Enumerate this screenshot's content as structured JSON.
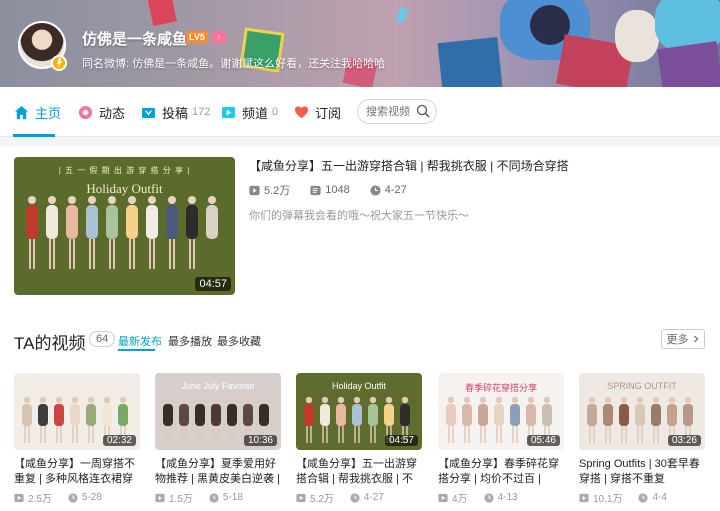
{
  "profile": {
    "name": "仿佛是一条咸鱼",
    "level": "LV5",
    "gender_badge": "♀",
    "sign": "同名微博: 仿佛是一条咸鱼。谢谢赋这么好看，还关注我哈哈哈"
  },
  "nav": {
    "items": [
      {
        "label": "主页",
        "icon": "home-icon",
        "active": true
      },
      {
        "label": "动态",
        "icon": "activity-icon"
      },
      {
        "label": "投稿",
        "icon": "upload-icon",
        "count": "172"
      },
      {
        "label": "频道",
        "icon": "channel-icon",
        "count": "0"
      },
      {
        "label": "订阅",
        "icon": "heart-icon"
      }
    ],
    "search_placeholder": "搜索视频"
  },
  "featured": {
    "title": "【咸鱼分享】五一出游穿搭合辑 | 帮我挑衣服 | 不同场合穿搭",
    "thumb_heading": "| 五 一 假 期 出 游 穿 搭 分 享 |",
    "thumb_title": "Holiday Outfit",
    "duration": "04:57",
    "plays": "5.2万",
    "danmaku": "1048",
    "date": "4-27",
    "desc": "你们的弹幕我会看的哦～祝大家五一节快乐～"
  },
  "videos_section": {
    "title": "TA的视频",
    "count": "64",
    "sorts": [
      "最新发布",
      "最多播放",
      "最多收藏"
    ],
    "more_label": "更多",
    "more_icon": "chevron-right-icon"
  },
  "videos": [
    {
      "title": "【咸鱼分享】一周穿搭不重复 | 多种风格连衣裙穿搭 | 穿小",
      "duration": "02:32",
      "plays": "2.5万",
      "date": "5-28",
      "bg": "#f3ede8",
      "thumb_text": ""
    },
    {
      "title": "【咸鱼分享】夏季爱用好物推荐 | 黑黄皮美白逆袭 | 最后有",
      "duration": "10:36",
      "plays": "1.5万",
      "date": "5-18",
      "bg": "#d7cfcc",
      "thumb_text": "June July Favorite"
    },
    {
      "title": "【咸鱼分享】五一出游穿搭合辑 | 帮我挑衣服 | 不同场合穿",
      "duration": "04:57",
      "plays": "5.2万",
      "date": "4-27",
      "bg": "#5e6c2e",
      "thumb_text": "Holiday Outfit"
    },
    {
      "title": "【咸鱼分享】春季碎花穿搭分享 | 均价不过百 | zara H&M快",
      "duration": "05:46",
      "plays": "4万",
      "date": "4-13",
      "bg": "#f6f2ef",
      "thumb_text": "春季碎花穿搭分享"
    },
    {
      "title": "Spring Outfits | 30套早春穿搭 | 穿搭不重复",
      "duration": "03:26",
      "plays": "10.1万",
      "date": "4-4",
      "bg": "#efe9e4",
      "thumb_text": "SPRING OUTFIT"
    }
  ],
  "colors": {
    "accent": "#00a1d6",
    "level": "#ff8b2c",
    "pink": "#fb7299"
  }
}
